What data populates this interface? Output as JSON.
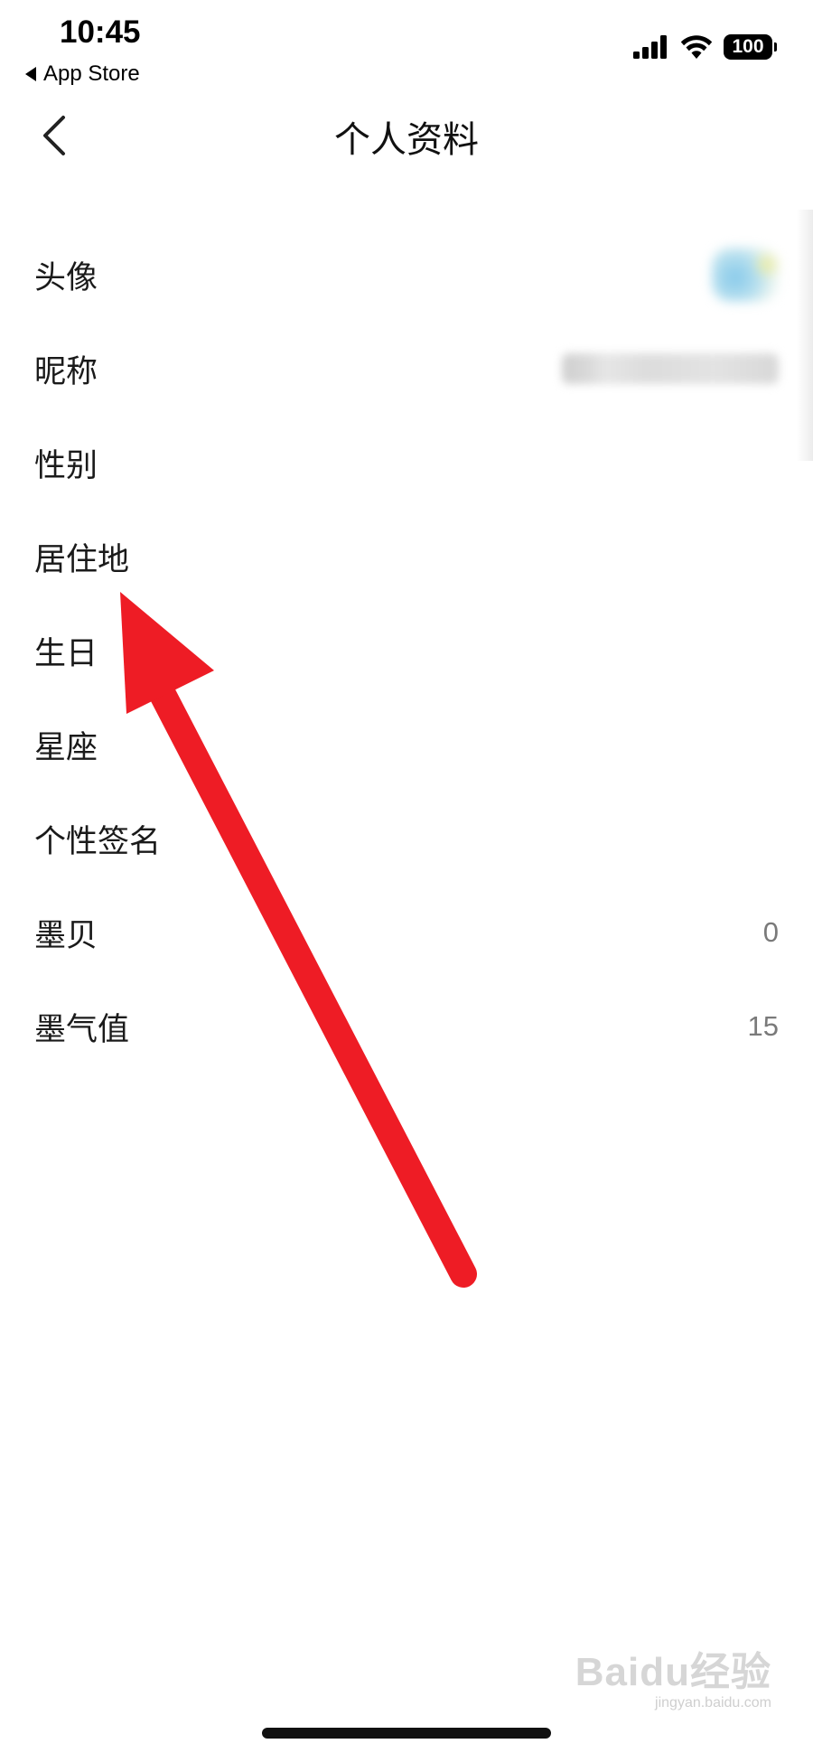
{
  "status_bar": {
    "time": "10:45",
    "back_app_label": "App Store",
    "battery": "100"
  },
  "nav": {
    "title": "个人资料"
  },
  "profile_rows": [
    {
      "label": "头像",
      "value": ""
    },
    {
      "label": "昵称",
      "value": ""
    },
    {
      "label": "性别",
      "value": ""
    },
    {
      "label": "居住地",
      "value": ""
    },
    {
      "label": "生日",
      "value": ""
    },
    {
      "label": "星座",
      "value": ""
    },
    {
      "label": "个性签名",
      "value": ""
    },
    {
      "label": "墨贝",
      "value": "0"
    },
    {
      "label": "墨气值",
      "value": "15"
    }
  ],
  "watermark": {
    "logo": "Baidu经验",
    "url": "jingyan.baidu.com"
  },
  "colors": {
    "annotation_arrow": "#ee1c25",
    "value_text": "#7a7a7a"
  }
}
